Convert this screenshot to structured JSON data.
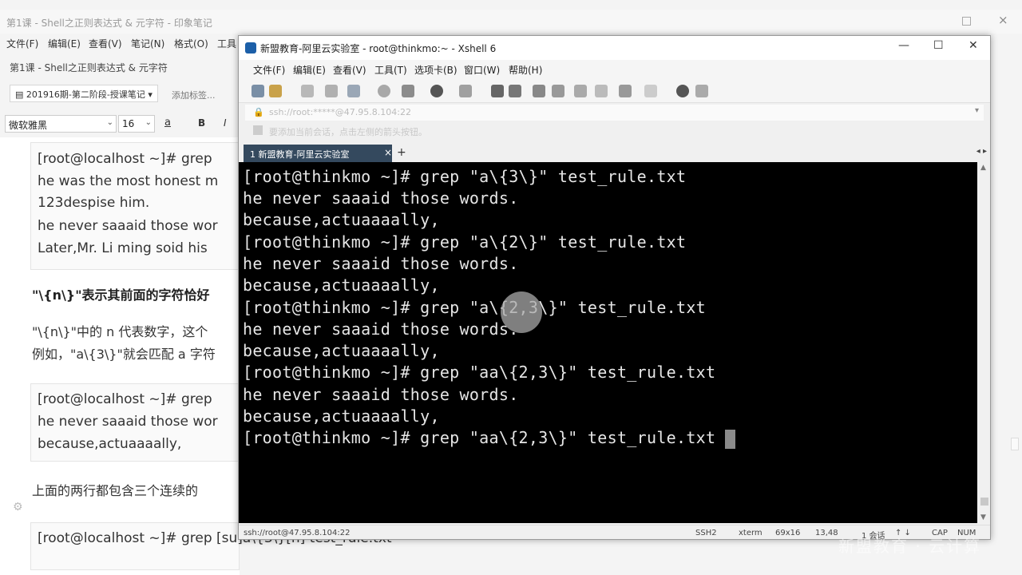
{
  "note_app": {
    "window_title": "第1课 - Shell之正则表达式 & 元字符 - 印象笔记",
    "menu": [
      "文件(F)",
      "编辑(E)",
      "查看(V)",
      "笔记(N)",
      "格式(O)",
      "工具"
    ],
    "page_title": "第1课 - Shell之正则表达式 & 元字符",
    "notebook": "201916期-第二阶段-授课笔记",
    "add_tag": "添加标签...",
    "font_name": "微软雅黑",
    "font_size": "16",
    "font_color_label": "a",
    "bold_label": "B",
    "italic_label": "I",
    "body": {
      "block1": [
        "[root@localhost ~]# grep",
        "he was the most honest m",
        "123despise him.",
        "he never saaaid those wor",
        "Later,Mr. Li ming soid his"
      ],
      "heading": "\"\\{n\\}\"表示其前面的字符恰好",
      "para1": "\"\\{n\\}\"中的 n 代表数字，这个",
      "para2": "例如，\"a\\{3\\}\"就会匹配 a 字符",
      "block2": [
        "[root@localhost ~]# grep",
        "he never saaaid those wor",
        "because,actuaaaally,"
      ],
      "para3": "上面的两行都包含三个连续的",
      "block3": "[root@localhost ~]# grep  [su]a\\{3\\}[n] test_rule.txt"
    }
  },
  "xshell": {
    "title": "新盟教育-阿里云实验室 - root@thinkmo:~ - Xshell 6",
    "menu": [
      "文件(F)",
      "编辑(E)",
      "查看(V)",
      "工具(T)",
      "选项卡(B)",
      "窗口(W)",
      "帮助(H)"
    ],
    "address": "ssh://root:*****@47.95.8.104:22",
    "hint": "要添加当前会话，点击左侧的箭头按钮。",
    "tab_label": "1 新盟教育-阿里云实验室",
    "terminal_lines": [
      "[root@thinkmo ~]# grep \"a\\{3\\}\" test_rule.txt",
      "he never saaaid those words.",
      "because,actuaaaally,",
      "[root@thinkmo ~]# grep \"a\\{2\\}\" test_rule.txt",
      "he never saaaid those words.",
      "because,actuaaaally,",
      "[root@thinkmo ~]# grep \"a\\{2,3\\}\" test_rule.txt",
      "he never saaaid those words.",
      "because,actuaaaally,",
      "[root@thinkmo ~]# grep \"aa\\{2,3\\}\" test_rule.txt",
      "he never saaaid those words.",
      "because,actuaaaally,",
      "[root@thinkmo ~]# grep \"aa\\{2,3\\}\" test_rule.txt"
    ],
    "status": {
      "connection": "ssh://root@47.95.8.104:22",
      "protocol": "SSH2",
      "terminal": "xterm",
      "size": "69x16",
      "cursor": "13,48",
      "sessions": "1 会话",
      "caps": "CAP",
      "num": "NUM"
    }
  },
  "watermark": "新盟教育 · 云计算"
}
